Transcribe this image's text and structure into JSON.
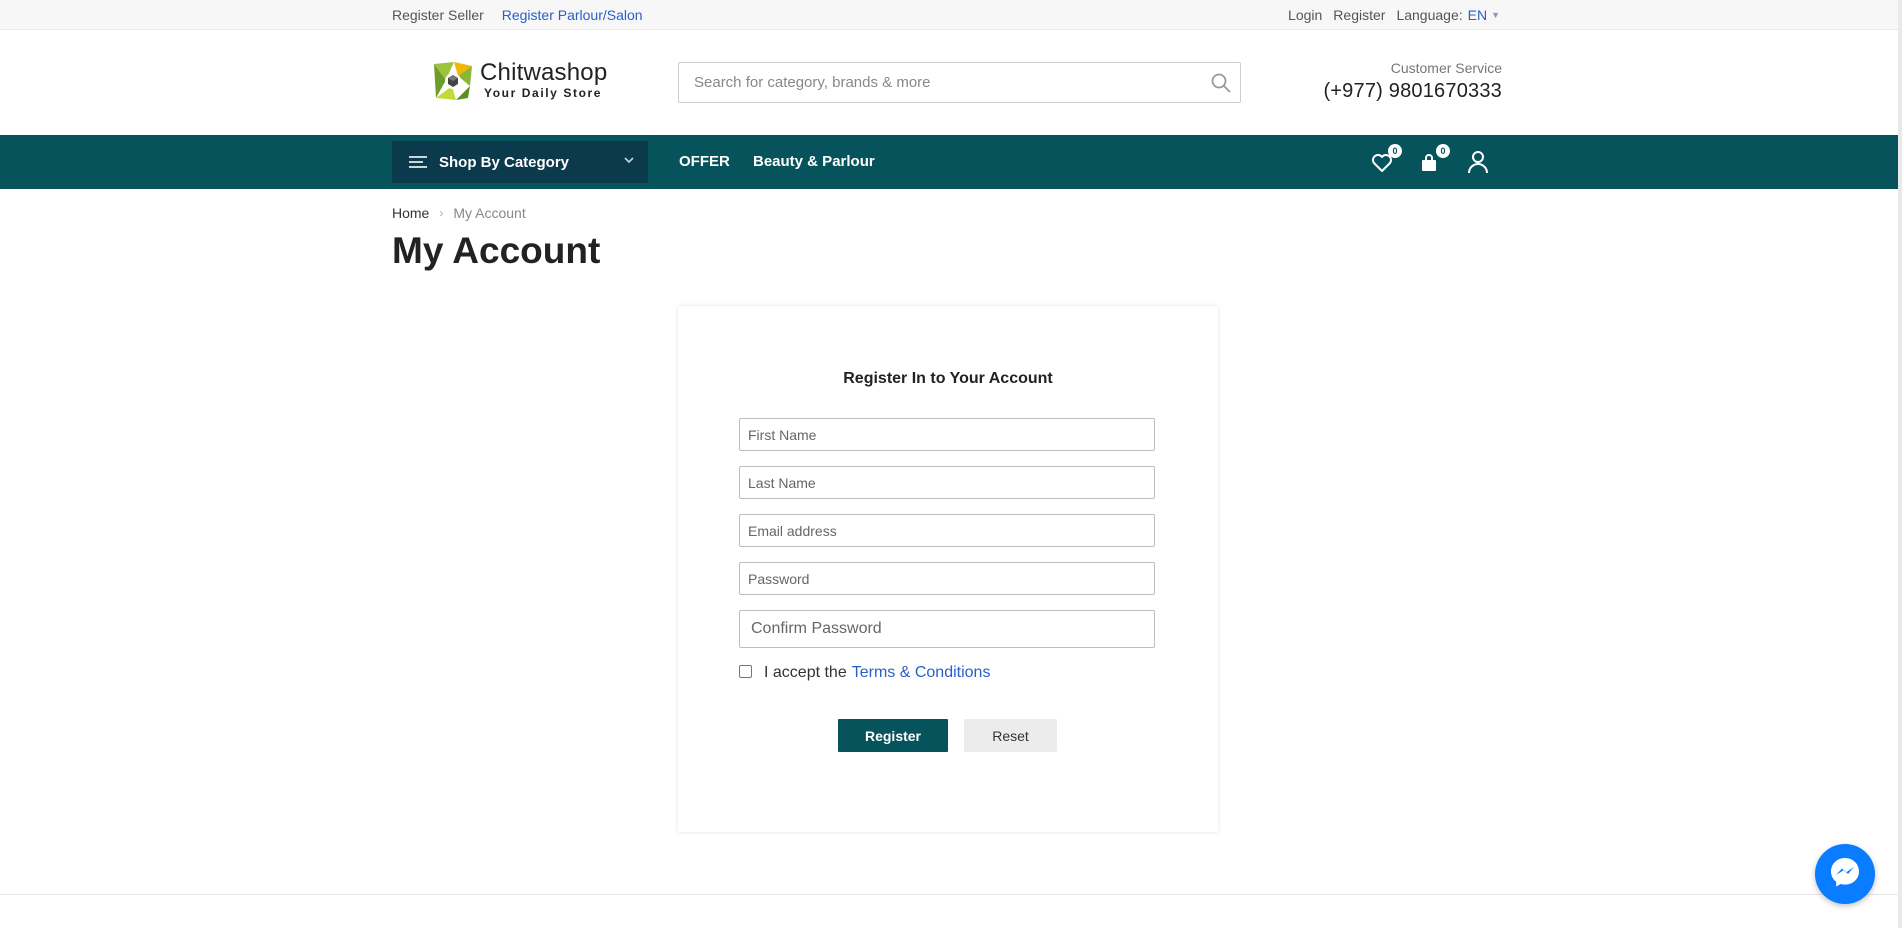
{
  "topbar": {
    "register_seller": "Register Seller",
    "register_parlour": "Register Parlour/Salon",
    "login": "Login",
    "register": "Register",
    "language_label": "Language:",
    "language_value": "EN"
  },
  "header": {
    "logo_name": "Chitwashop",
    "logo_tagline": "Your Daily Store",
    "search_placeholder": "Search for category, brands & more",
    "customer_service_label": "Customer Service",
    "customer_service_phone": "(+977) 9801670333"
  },
  "nav": {
    "category_button": "Shop By Category",
    "links": [
      "OFFER",
      "Beauty & Parlour"
    ],
    "wishlist_count": "0",
    "cart_count": "0"
  },
  "breadcrumb": {
    "home": "Home",
    "current": "My Account"
  },
  "page": {
    "title": "My Account"
  },
  "form": {
    "heading": "Register In to Your Account",
    "first_name_placeholder": "First Name",
    "last_name_placeholder": "Last Name",
    "email_placeholder": "Email address",
    "password_placeholder": "Password",
    "confirm_password_placeholder": "Confirm Password",
    "terms_prefix": "I accept the",
    "terms_link": "Terms & Conditions",
    "register_button": "Register",
    "reset_button": "Reset"
  },
  "colors": {
    "nav_bg": "#07535b",
    "category_bg": "#0b3a4d",
    "link_blue": "#2a5fc7",
    "messenger_blue": "#0a7cff"
  },
  "icons": [
    "search-icon",
    "menu-icon",
    "chevron-down-icon",
    "heart-icon",
    "shopping-bag-icon",
    "user-icon",
    "messenger-icon"
  ]
}
